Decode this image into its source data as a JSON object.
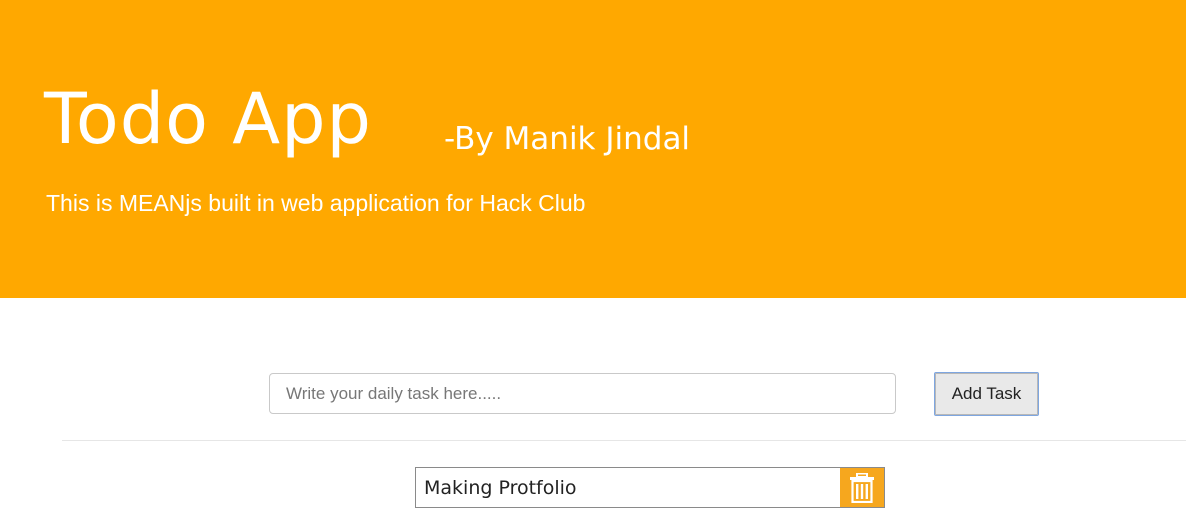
{
  "header": {
    "title": "Todo App",
    "author": "-By Manik Jindal",
    "subtitle": "This is MEANjs built in web application for Hack Club",
    "background_color": "#ffa800"
  },
  "task_form": {
    "input_value": "",
    "input_placeholder": "Write your daily task here.....",
    "add_button_label": "Add Task"
  },
  "tasks": [
    {
      "text": "Making Protfolio",
      "delete_icon": "trash-icon",
      "delete_button_color": "#f6a71e"
    }
  ]
}
